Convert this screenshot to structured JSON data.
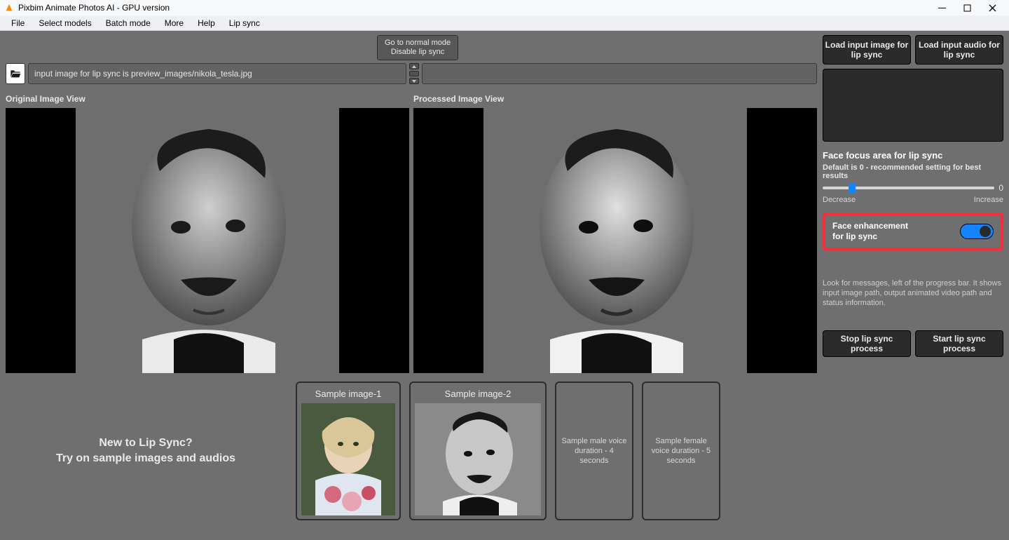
{
  "title": "Pixbim Animate Photos AI - GPU version",
  "menu": [
    "File",
    "Select models",
    "Batch mode",
    "More",
    "Help",
    "Lip sync"
  ],
  "mode_button": {
    "line1": "Go to normal mode",
    "line2": "Disable lip sync"
  },
  "path_text": "input image for lip sync is preview_images/nikola_tesla.jpg",
  "view_labels": {
    "original": "Original Image View",
    "processed": "Processed Image View"
  },
  "hint": {
    "line1": "New to Lip Sync?",
    "line2": "Try on sample images and audios"
  },
  "samples": {
    "img1": "Sample image-1",
    "img2": "Sample image-2"
  },
  "audio_samples": {
    "male": "Sample male voice duration - 4 seconds",
    "female": "Sample female voice duration - 5 seconds"
  },
  "sidebar": {
    "load_image": "Load input image for lip sync",
    "load_audio": "Load input audio for lip sync",
    "slider_title": "Face focus area for lip sync",
    "slider_sub": "Default is 0 - recommended setting for best results",
    "slider_value": "0",
    "slider_percent": 15,
    "slider_dec": "Decrease",
    "slider_inc": "Increase",
    "enhance_l1": "Face enhancement",
    "enhance_l2": "for lip sync",
    "message": "Look for messages, left of the progress bar. It shows input image path, output animated video path and status information.",
    "stop": "Stop lip sync process",
    "start": "Start lip sync process"
  }
}
